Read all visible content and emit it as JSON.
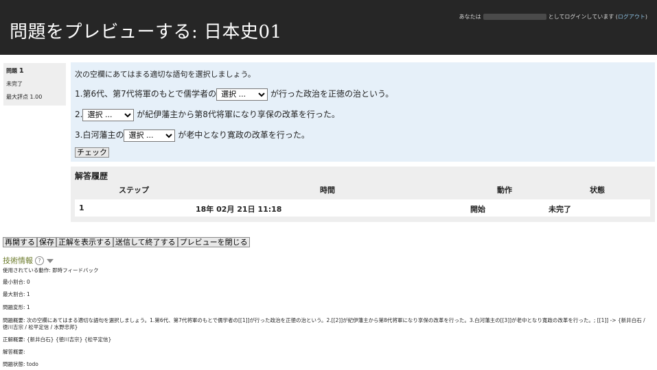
{
  "header": {
    "title": "問題をプレビューする: 日本史01",
    "login_prefix": "あなたは",
    "login_suffix": "としてログインしています",
    "logout_label": "ログアウト"
  },
  "question_info": {
    "label": "問題",
    "number": "1",
    "state": "未完了",
    "max_grade_label": "最大評点",
    "max_grade": "1.00"
  },
  "question": {
    "instruction": "次の空欄にあてはまる適切な語句を選択しましょう。",
    "select_placeholder": "選択 ...",
    "line1_before": "1.第6代、第7代将軍のもとで儒学者の",
    "line1_after": "が行った政治を正徳の治という。",
    "line2_before": "2.",
    "line2_after": "が紀伊藩主から第8代将軍になり享保の改革を行った。",
    "line3_before": "3.白河藩主の",
    "line3_after": "が老中となり寛政の改革を行った。",
    "check_label": "チェック"
  },
  "history": {
    "title": "解答履歴",
    "headers": {
      "step": "ステップ",
      "time": "時間",
      "action": "動作",
      "state": "状態"
    },
    "rows": [
      {
        "step": "1",
        "time": "18年 02月 21日 11:18",
        "action": "開始",
        "state": "未完了"
      }
    ]
  },
  "buttons": {
    "restart": "再開する",
    "save": "保存",
    "fill_correct": "正解を表示する",
    "submit_finish": "送信して終了する",
    "close_preview": "プレビューを閉じる"
  },
  "tech": {
    "title": "技術情報",
    "behaviour": "使用されている動作: 即時フィードバック",
    "min_fraction": "最小割合: 0",
    "max_fraction": "最大割合: 1",
    "variant": "問題変形: 1",
    "summary_line1": "問題概要: 次の空欄にあてはまる適切な語句を選択しましょう。1.第6代、第7代将軍のもとで儒学者の[[1]]が行った政治を正徳の治という。2.[[2]]が紀伊藩主から第8代将軍になり享保の改革を行った。3.白河藩主の[[3]]が老中となり寛政の改革を行った。; [[1]] -> {新井白石 /",
    "summary_line2": "徳川吉宗 / 松平定信 / 水野忠邦}",
    "right_answer": "正解概要: {新井白石} {徳川吉宗} {松平定信}",
    "response_summary": "解答概要:",
    "question_state": "問題状態: todo"
  }
}
